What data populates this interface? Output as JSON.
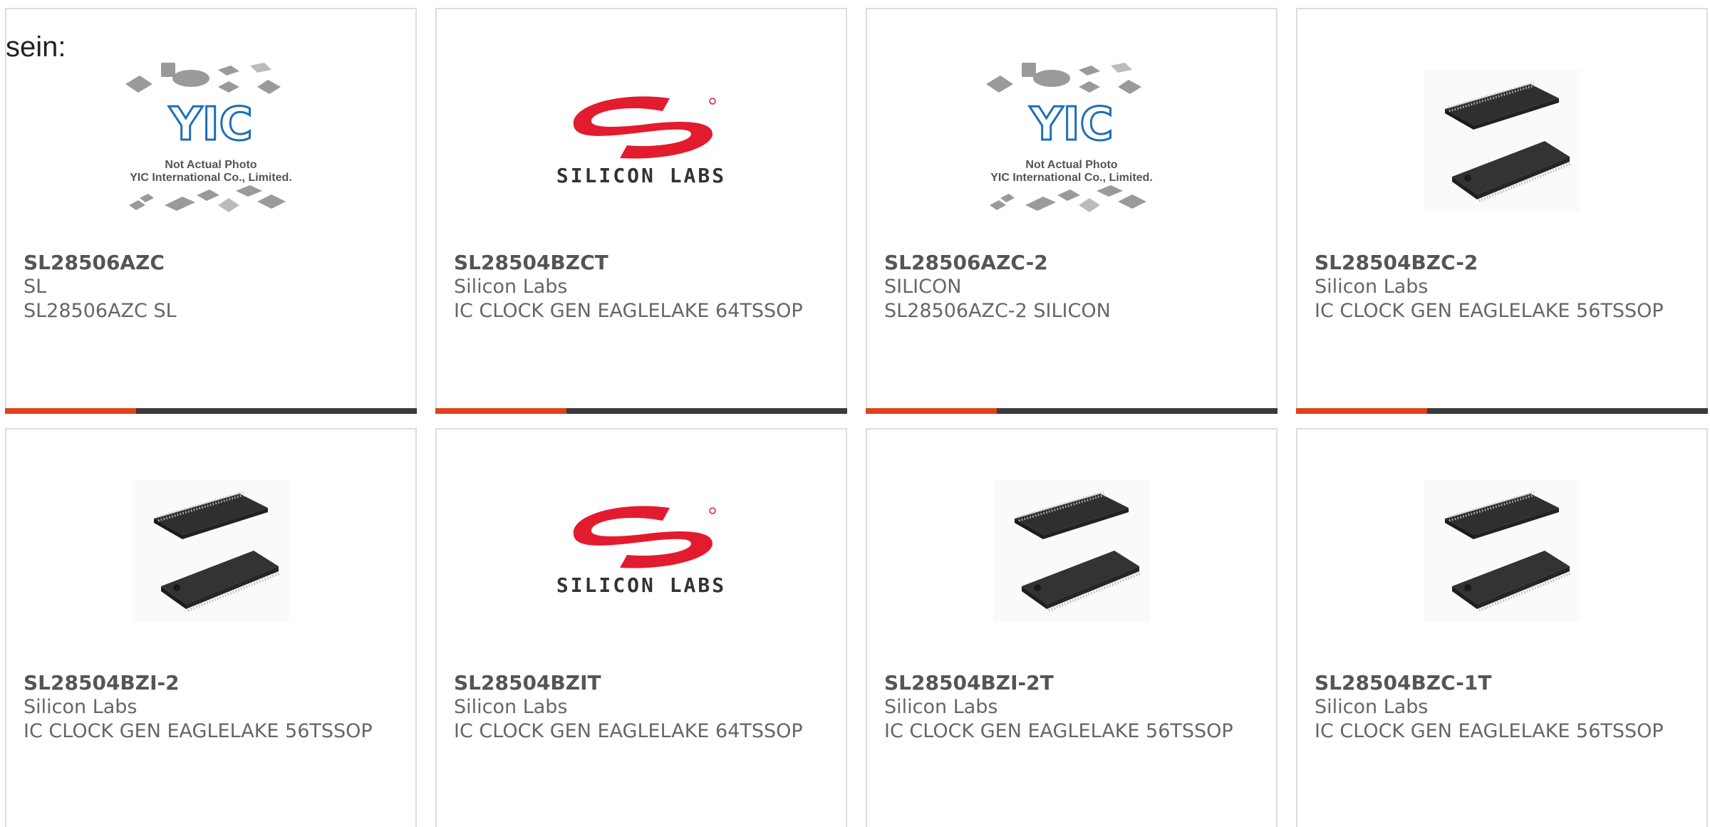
{
  "top_text": "sein:",
  "products": [
    {
      "part": "SL28506AZC",
      "maker": "SL",
      "desc": "SL28506AZC SL",
      "image": "yic-placeholder",
      "yic_line1": "Not Actual Photo",
      "yic_line2": "YIC International Co., Limited."
    },
    {
      "part": "SL28504BZCT",
      "maker": "Silicon Labs",
      "desc": "IC CLOCK GEN EAGLELAKE 64TSSOP",
      "image": "silicon-labs-logo",
      "logo_text": "SILICON LABS"
    },
    {
      "part": "SL28506AZC-2",
      "maker": "SILICON",
      "desc": "SL28506AZC-2 SILICON",
      "image": "yic-placeholder",
      "yic_line1": "Not Actual Photo",
      "yic_line2": "YIC International Co., Limited."
    },
    {
      "part": "SL28504BZC-2",
      "maker": "Silicon Labs",
      "desc": "IC CLOCK GEN EAGLELAKE 56TSSOP",
      "image": "tssop-chip"
    },
    {
      "part": "SL28504BZI-2",
      "maker": "Silicon Labs",
      "desc": "IC CLOCK GEN EAGLELAKE 56TSSOP",
      "image": "tssop-chip"
    },
    {
      "part": "SL28504BZIT",
      "maker": "Silicon Labs",
      "desc": "IC CLOCK GEN EAGLELAKE 64TSSOP",
      "image": "silicon-labs-logo",
      "logo_text": "SILICON LABS"
    },
    {
      "part": "SL28504BZI-2T",
      "maker": "Silicon Labs",
      "desc": "IC CLOCK GEN EAGLELAKE 56TSSOP",
      "image": "tssop-chip"
    },
    {
      "part": "SL28504BZC-1T",
      "maker": "Silicon Labs",
      "desc": "IC CLOCK GEN EAGLELAKE 56TSSOP",
      "image": "tssop-chip"
    }
  ],
  "colors": {
    "accent": "#e2401c",
    "bar": "#3a3a3a",
    "logo_red": "#e31b2f",
    "yic_blue": "#1d6fb8"
  }
}
